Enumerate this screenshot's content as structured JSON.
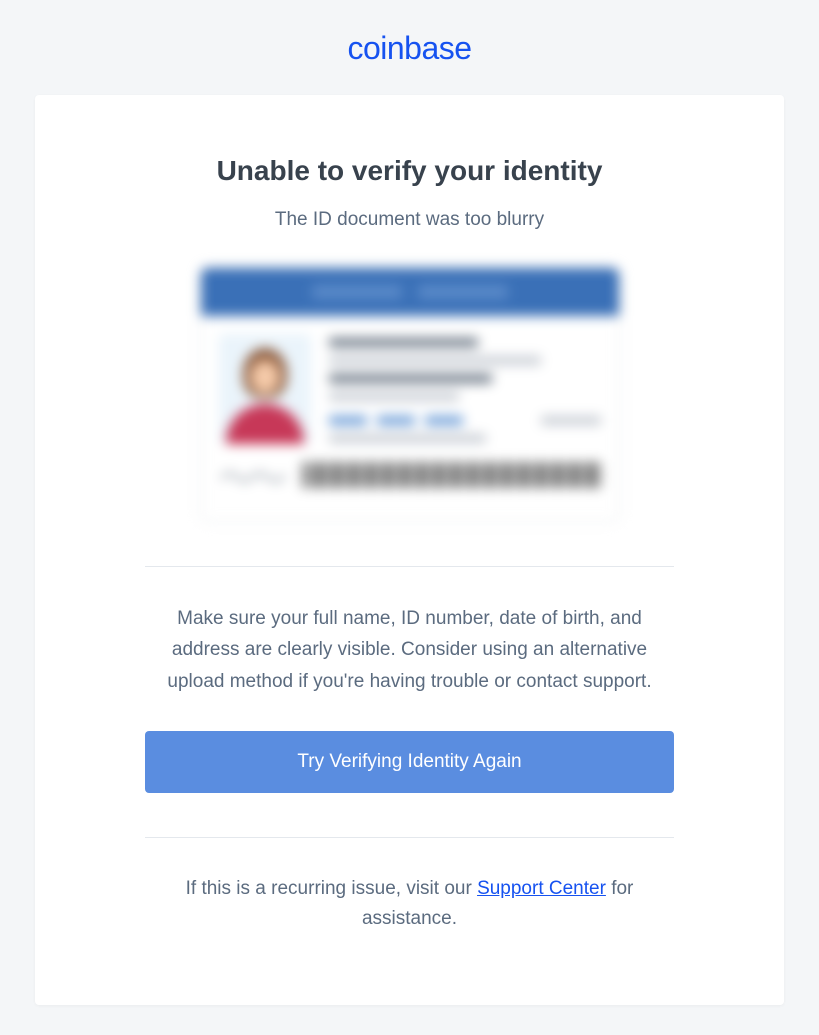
{
  "brand": {
    "name": "coinbase"
  },
  "main": {
    "heading": "Unable to verify your identity",
    "subheading": "The ID document was too blurry",
    "body_text": "Make sure your full name, ID number, date of birth, and address are clearly visible. Consider using an alternative upload method if you're having trouble or contact support.",
    "cta_label": "Try Verifying Identity Again",
    "footer_prefix": "If this is a recurring issue, visit our ",
    "footer_link_label": "Support Center",
    "footer_suffix": " for assistance."
  }
}
